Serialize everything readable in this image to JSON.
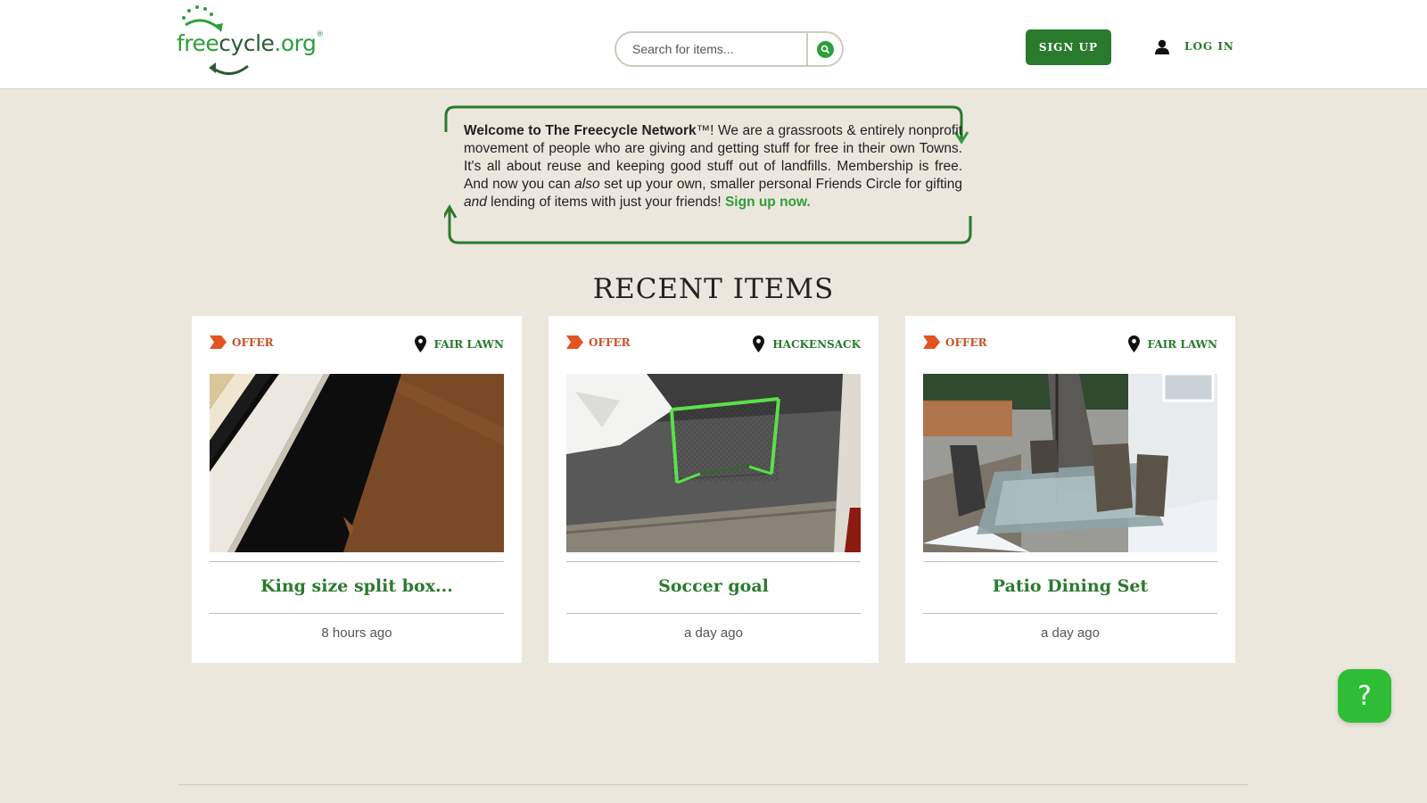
{
  "header": {
    "logo": {
      "free": "free",
      "cycle": "cycle",
      "org": ".org",
      "reg": "®"
    },
    "search": {
      "placeholder": "Search for items..."
    },
    "signup_label": "SIGN UP",
    "login_label": "LOG IN"
  },
  "welcome": {
    "intro_bold": "Welcome to The Freecycle Network",
    "tm": "™",
    "text1": "! We are a grassroots & entirely nonprofit movement of people who are giving and getting stuff for free in their own Towns. It's all about reuse and keeping good stuff out of landfills. Membership is free. And now you can ",
    "also": "also",
    "text2": " set up your own, smaller personal Friends Circle for gifting ",
    "and": "and",
    "text3": " lending of items with just your friends! ",
    "cta": "Sign up now."
  },
  "recent": {
    "title": "RECENT ITEMS",
    "items": [
      {
        "type": "OFFER",
        "location": "FAIR LAWN",
        "title": "King size split box...",
        "time": "8 hours ago"
      },
      {
        "type": "OFFER",
        "location": "HACKENSACK",
        "title": "Soccer goal",
        "time": "a day ago"
      },
      {
        "type": "OFFER",
        "location": "FAIR LAWN",
        "title": "Patio Dining Set",
        "time": "a day ago"
      }
    ]
  },
  "help": {
    "label": "?"
  },
  "colors": {
    "brand_green": "#2a7a2e",
    "light_green": "#2e9e3a",
    "offer_orange": "#c8502a",
    "bg": "#ece7dd"
  }
}
